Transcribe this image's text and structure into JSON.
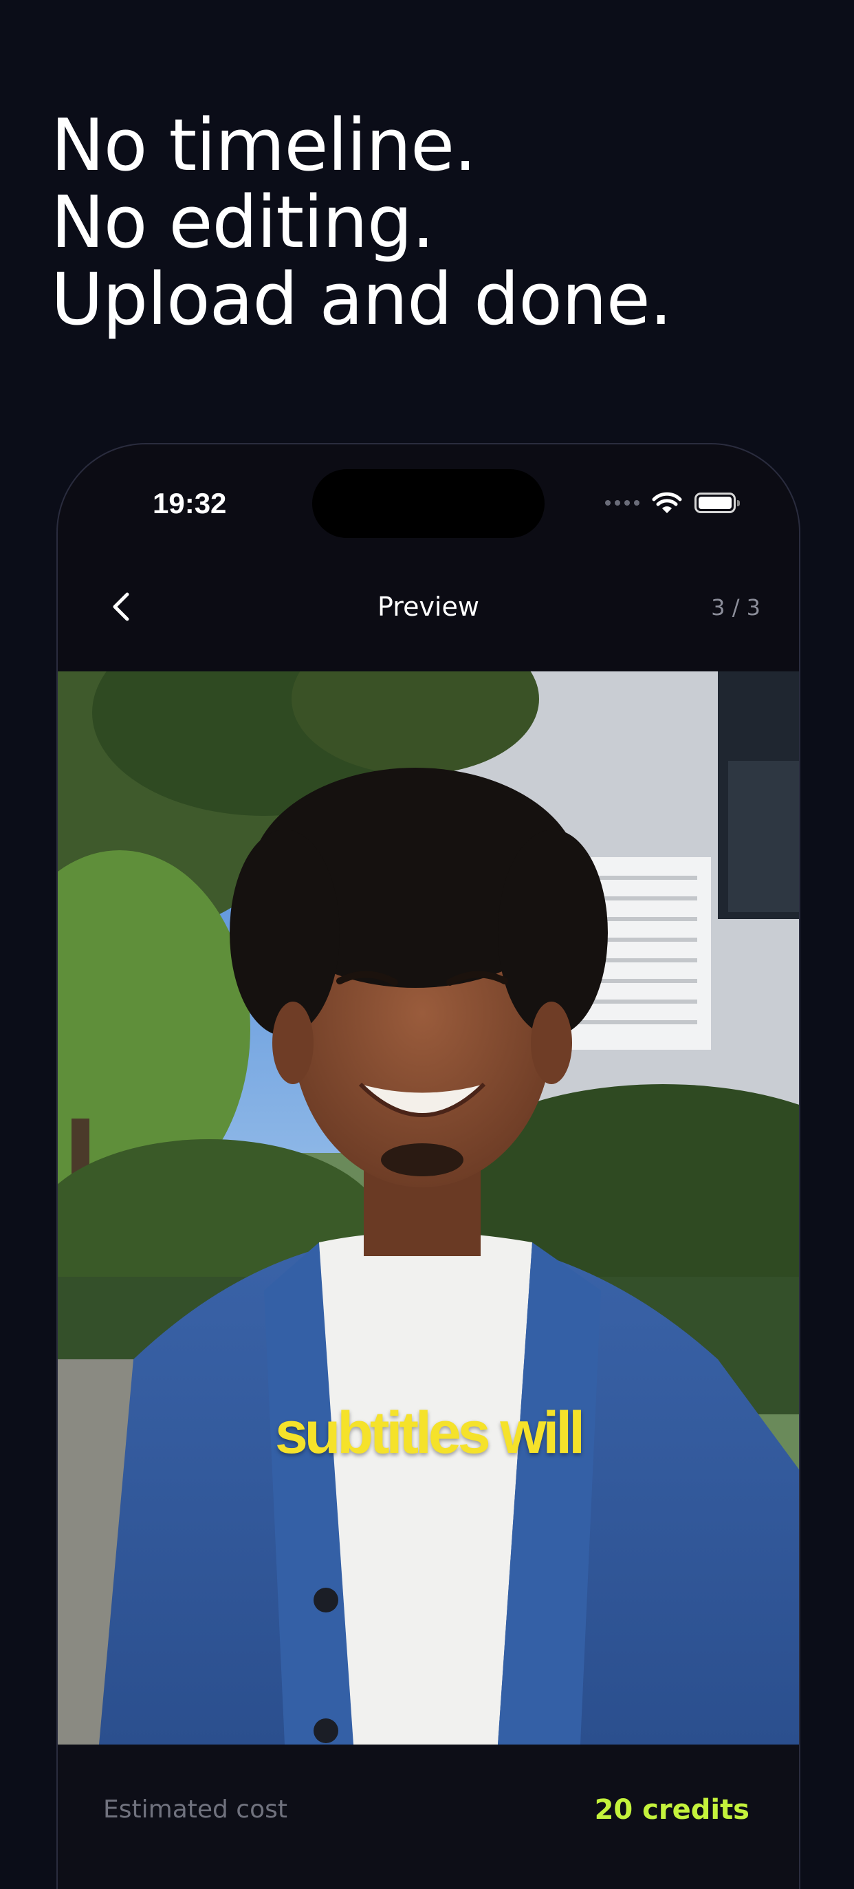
{
  "headline": {
    "line1": "No timeline.",
    "line2": "No editing.",
    "line3": "Upload and done."
  },
  "status_bar": {
    "time": "19:32",
    "icons": [
      "signal-dots-icon",
      "wifi-icon",
      "battery-icon"
    ]
  },
  "nav": {
    "back_icon": "chevron-left-icon",
    "title": "Preview",
    "step": "3 / 3"
  },
  "video": {
    "subtitle": "subtitles will"
  },
  "cost": {
    "label": "Estimated cost",
    "value": "20 credits"
  },
  "colors": {
    "background": "#0b0d18",
    "accent": "#c4f23c",
    "subtitle": "#f5e22a"
  }
}
